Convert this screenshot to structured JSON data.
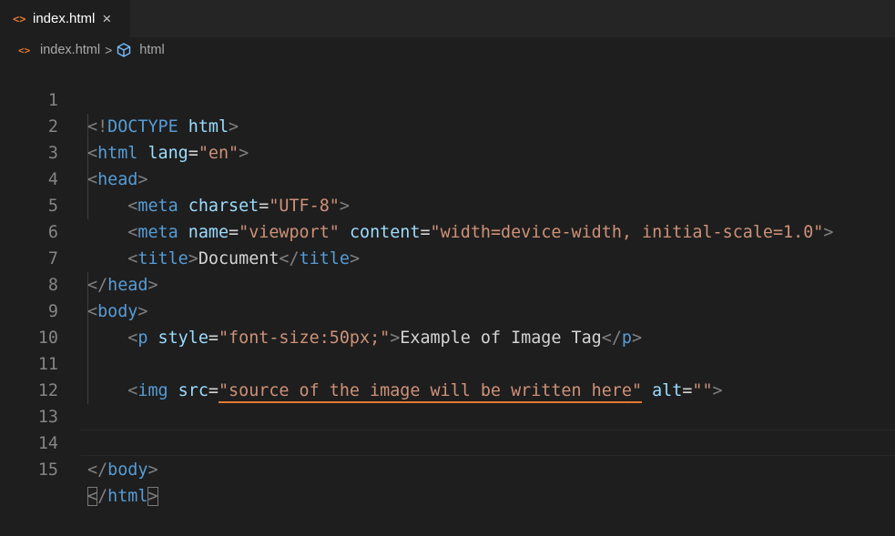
{
  "tab": {
    "filename": "index.html",
    "icon": "<>",
    "close": "×"
  },
  "breadcrumb": {
    "file": "index.html",
    "separator": ">",
    "node": "html",
    "file_icon": "<>"
  },
  "line_numbers": [
    "1",
    "2",
    "3",
    "4",
    "5",
    "6",
    "7",
    "8",
    "9",
    "10",
    "11",
    "12",
    "13",
    "14",
    "15"
  ],
  "code": {
    "l1": {
      "open": "<!",
      "doctype": "DOCTYPE",
      "html": "html",
      "close": ">"
    },
    "l2": {
      "lt": "<",
      "tag": "html",
      "attr": "lang",
      "eq": "=",
      "val": "\"en\"",
      "gt": ">"
    },
    "l3": {
      "lt": "<",
      "tag": "head",
      "gt": ">"
    },
    "l4": {
      "lt": "<",
      "tag": "meta",
      "attr": "charset",
      "eq": "=",
      "val": "\"UTF-8\"",
      "gt": ">"
    },
    "l5": {
      "lt": "<",
      "tag": "meta",
      "attr1": "name",
      "eq1": "=",
      "val1": "\"viewport\"",
      "attr2": "content",
      "eq2": "=",
      "val2": "\"width=device-width, initial-scale=1.0\"",
      "gt": ">"
    },
    "l6": {
      "lt": "<",
      "tag": "title",
      "gt": ">",
      "text": "Document",
      "lt2": "</",
      "tag2": "title",
      "gt2": ">"
    },
    "l7": {
      "lt": "</",
      "tag": "head",
      "gt": ">"
    },
    "l8": {
      "lt": "<",
      "tag": "body",
      "gt": ">"
    },
    "l9": {
      "lt": "<",
      "tag": "p",
      "attr": "style",
      "eq": "=",
      "val": "\"font-size:50px;\"",
      "gt": ">",
      "text": "Example of Image Tag",
      "lt2": "</",
      "tag2": "p",
      "gt2": ">"
    },
    "l11": {
      "lt": "<",
      "tag": "img",
      "attr": "src",
      "eq": "=",
      "q1": "\"",
      "val": "source of the image will be written here",
      "q2": "\"",
      "attr2": "alt",
      "eq2": "=",
      "val2": "\"\"",
      "gt": ">"
    },
    "l14": {
      "lt": "</",
      "tag": "body",
      "gt": ">"
    },
    "l15": {
      "lt": "<",
      "slash": "/",
      "tag": "html",
      "gt": ">"
    }
  }
}
